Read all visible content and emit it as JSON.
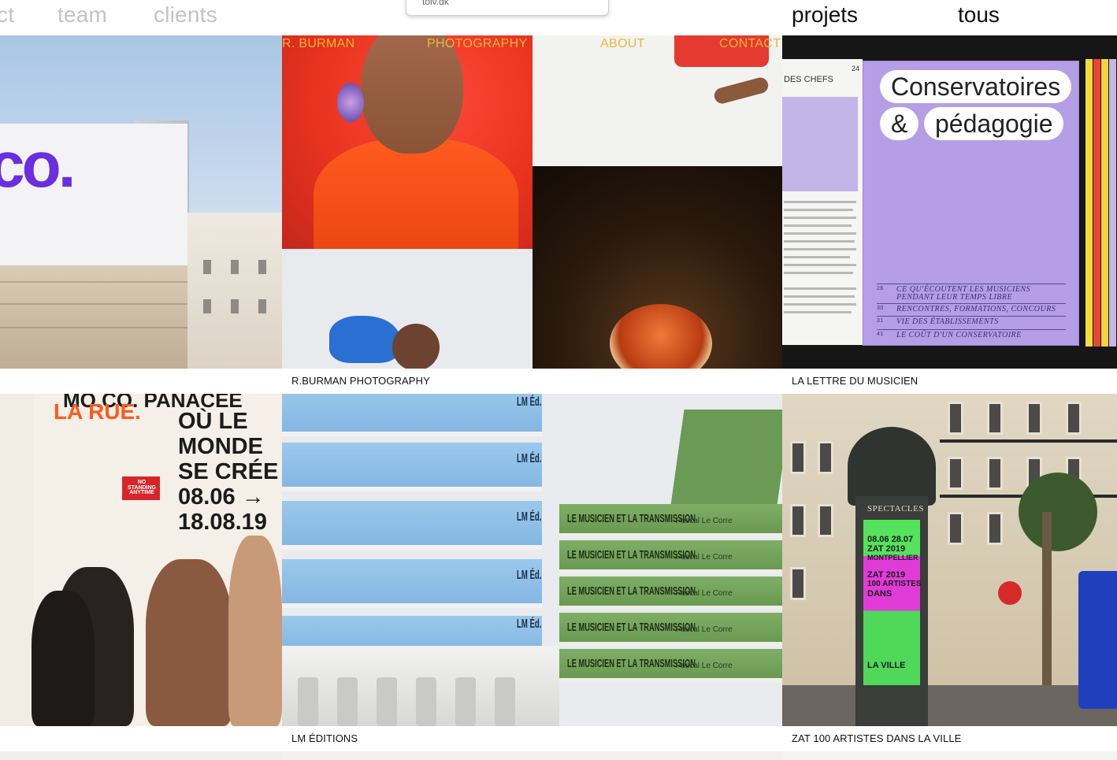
{
  "nav": {
    "left_items": [
      "ct",
      "team",
      "clients"
    ],
    "right_items": [
      "projets",
      "tous"
    ]
  },
  "url_popup": {
    "text": "tolv.dk"
  },
  "tiles": {
    "building": {
      "caption": "",
      "logo_text": "co."
    },
    "burman": {
      "caption": "R.BURMAN PHOTOGRAPHY",
      "overlay_nav": [
        "R. BURMAN",
        "PHOTOGRAPHY",
        "ABOUT",
        "CONTACT"
      ]
    },
    "magazine": {
      "caption": "LA LETTRE DU MUSICIEN",
      "page_heading": "DES CHEFS",
      "page_number": "24",
      "cover_line1": "Conservatoires",
      "cover_amp": "&",
      "cover_line2": "pédagogie",
      "toc": [
        {
          "num": "26",
          "text": "CE QU'ÉCOUTENT LES MUSICIENS"
        },
        {
          "num": "",
          "text": "PENDANT LEUR TEMPS LIBRE"
        },
        {
          "num": "30",
          "text": "RENCONTRES, FORMATIONS, CONCOURS"
        },
        {
          "num": "31",
          "text": "VIE DES ÉTABLISSEMENTS"
        },
        {
          "num": "41",
          "text": "LE COÛT D'UN CONSERVATOIRE"
        }
      ]
    },
    "posters": {
      "caption": "",
      "lines": [
        "LA RUE.",
        "OÙ LE",
        "MONDE",
        "SE CRÉE",
        "08.06 →",
        "18.08.19"
      ],
      "top_line": "MO.CO. PANACÉE",
      "sign_text": "NO STANDING ANYTIME"
    },
    "books": {
      "caption": "LM ÉDITIONS",
      "spine_label": "LM Éd.",
      "green_title": "LE MUSICIEN ET LA TRANSMISSION",
      "green_author": "Pascal Le Corre"
    },
    "street": {
      "caption": "ZAT 100 ARTISTES DANS LA VILLE",
      "column_heading": "SPECTACLES",
      "poster_lines": [
        "08.06 28.07",
        "ZAT 2019",
        "MONTPELLIER",
        "ZAT 2019",
        "100 ARTISTES",
        "DANS",
        "LA VILLE"
      ]
    }
  },
  "colors": {
    "nav_inactive": "#c4c4c4",
    "nav_active": "#111111",
    "mo_co_purple": "#6a2ee0",
    "magazine_lilac": "#b59ee6",
    "burman_nav_yellow": "#e9b73a",
    "books_blue": "#8fc0e8",
    "books_green": "#74a45c"
  }
}
